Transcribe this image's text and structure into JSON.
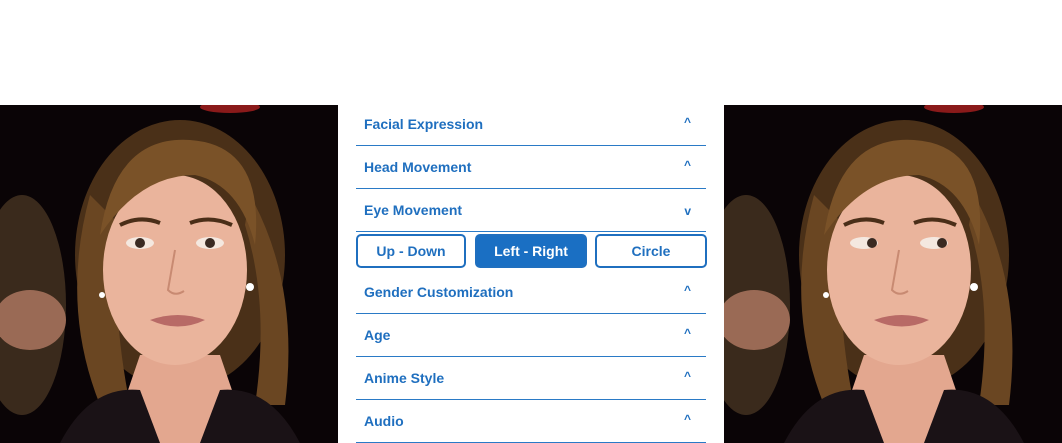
{
  "images": {
    "left": {
      "label": "source-face"
    },
    "right": {
      "label": "result-face"
    }
  },
  "panel": {
    "sections": [
      {
        "label": "Facial Expression",
        "state": "collapsed",
        "chevron": "^"
      },
      {
        "label": "Head Movement",
        "state": "collapsed",
        "chevron": "^"
      },
      {
        "label": "Eye Movement",
        "state": "expanded",
        "chevron": "v"
      },
      {
        "label": "Gender Customization",
        "state": "collapsed",
        "chevron": "^"
      },
      {
        "label": "Age",
        "state": "collapsed",
        "chevron": "^"
      },
      {
        "label": "Anime Style",
        "state": "collapsed",
        "chevron": "^"
      },
      {
        "label": "Audio",
        "state": "collapsed",
        "chevron": "^"
      }
    ],
    "eye_movement_options": [
      {
        "label": "Up - Down",
        "selected": false
      },
      {
        "label": "Left - Right",
        "selected": true
      },
      {
        "label": "Circle",
        "selected": false
      }
    ]
  },
  "colors": {
    "accent": "#1f6fbf",
    "active_button_bg": "#1a6fc3",
    "background": "#ffffff",
    "photo_background": "#0a0406"
  }
}
